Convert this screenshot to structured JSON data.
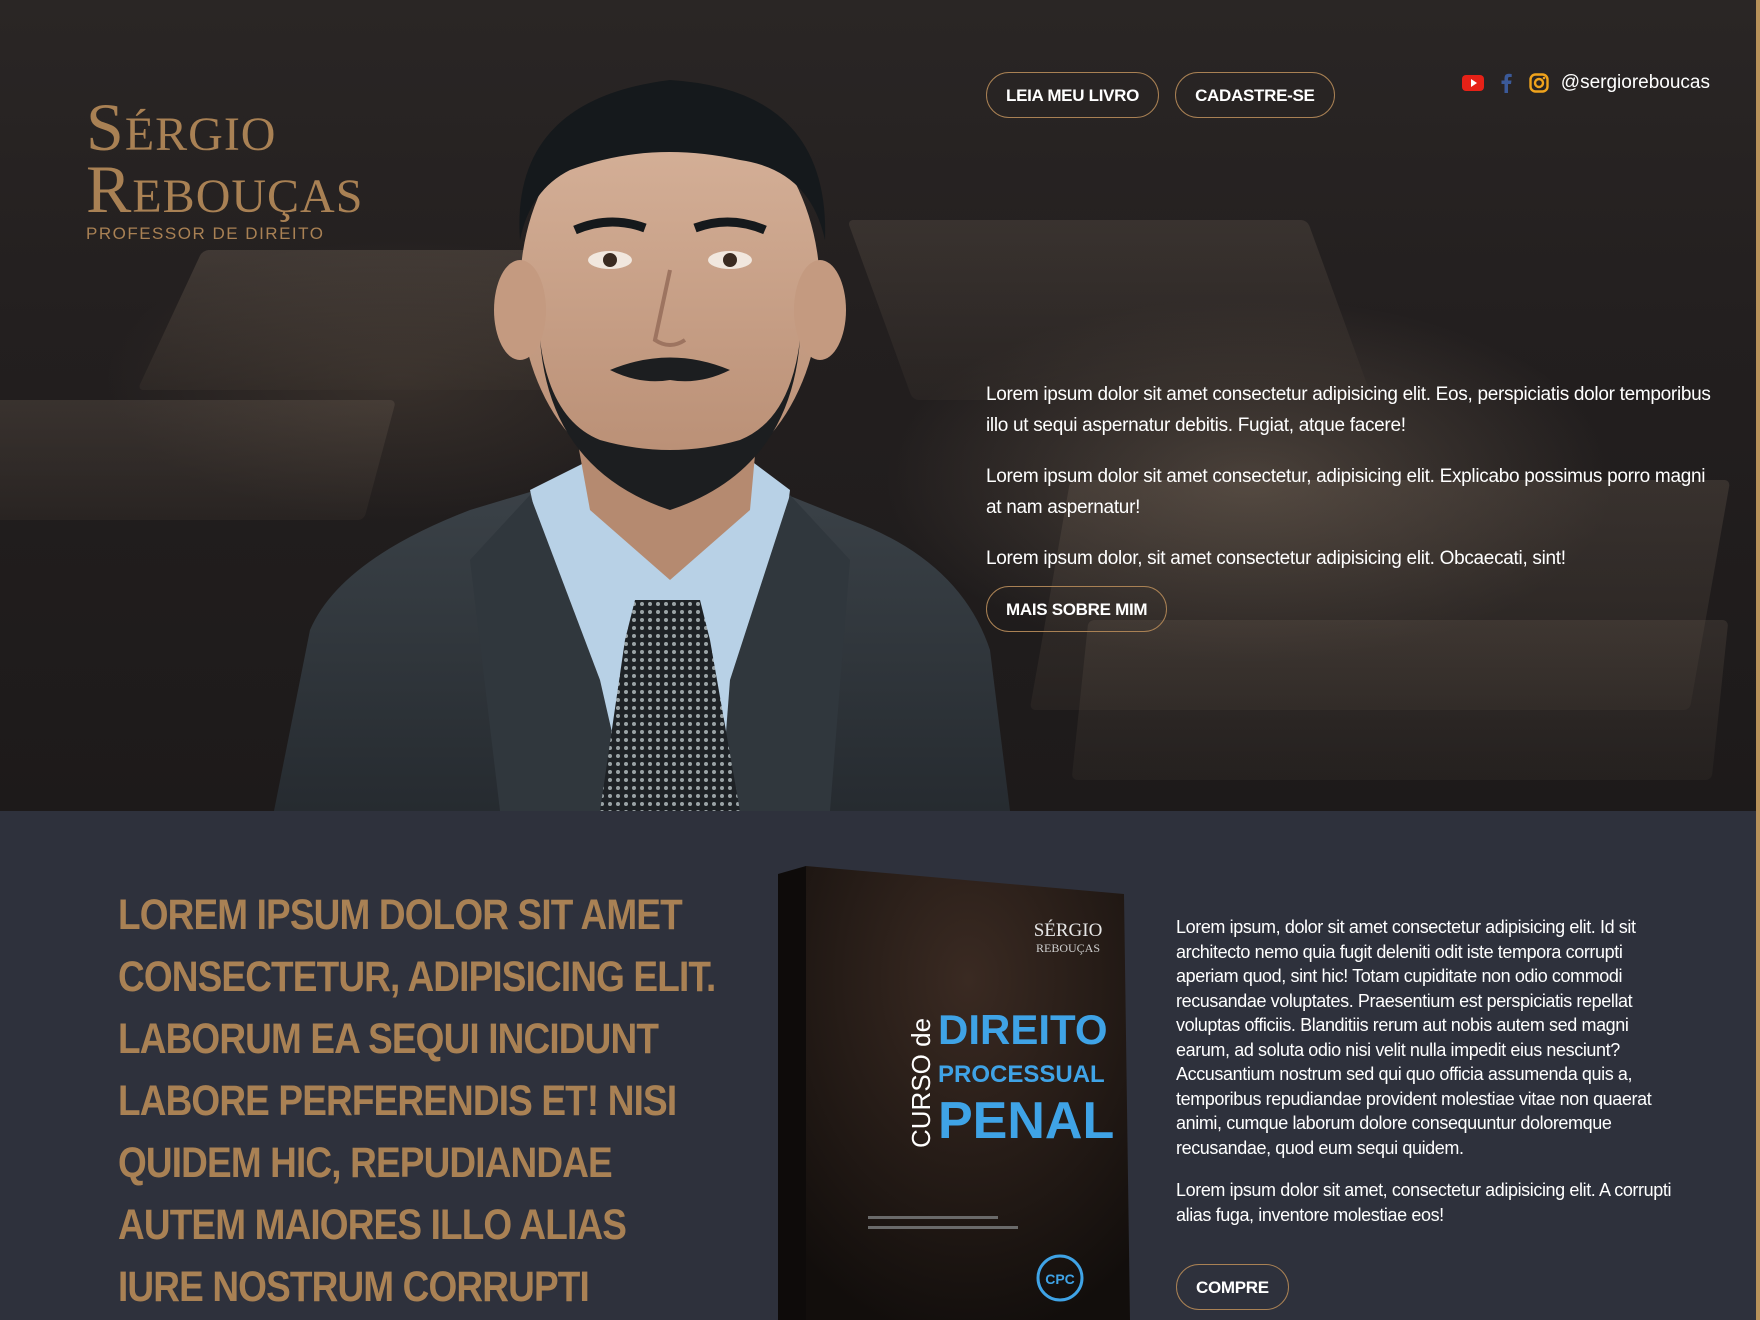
{
  "brand": {
    "name_line1": "Sérgio",
    "name_line2": "Rebouças",
    "subtitle": "PROFESSOR DE DIREITO",
    "accent_color": "#a98154"
  },
  "nav": {
    "read_book": "LEIA MEU LIVRO",
    "signup": "CADASTRE-SE"
  },
  "social": {
    "icons": [
      "youtube-icon",
      "facebook-icon",
      "instagram-icon"
    ],
    "handle": "@sergioreboucas"
  },
  "hero": {
    "paragraphs": [
      "Lorem ipsum dolor sit amet consectetur adipisicing elit. Eos, perspiciatis dolor temporibus illo ut sequi aspernatur debitis. Fugiat, atque facere!",
      "Lorem ipsum dolor sit amet consectetur, adipisicing elit. Explicabo possimus porro magni at nam aspernatur!",
      "Lorem ipsum dolor, sit amet consectetur adipisicing elit. Obcaecati, sint!"
    ],
    "cta": "MAIS SOBRE MIM"
  },
  "book_section": {
    "headline": "Lorem ipsum dolor sit amet consectetur, adipisicing elit. Laborum ea sequi incidunt labore perferendis et! Nisi quidem hic, repudiandae autem maiores illo alias iure nostrum corrupti excepturi animi ipsa? Omnis.",
    "book_cover": {
      "author_line1": "SÉRGIO",
      "author_line2": "REBOUÇAS",
      "curso": "CURSO de",
      "title_line1": "DIREITO",
      "title_line2": "PROCESSUAL",
      "title_line3": "PENAL",
      "badge": "CPC"
    },
    "paragraphs": [
      "Lorem ipsum, dolor sit amet consectetur adipisicing elit. Id sit architecto nemo quia fugit deleniti odit iste tempora corrupti aperiam quod, sint hic! Totam cupiditate non odio commodi recusandae voluptates. Praesentium est perspiciatis repellat voluptas officiis. Blanditiis rerum aut nobis autem sed magni earum, ad soluta odio nisi velit nulla impedit eius nesciunt? Accusantium nostrum sed qui quo officia assumenda quis a, temporibus repudiandae provident molestiae vitae non quaerat animi, cumque laborum dolore consequuntur doloremque recusandae, quod eum sequi quidem.",
      "Lorem ipsum dolor sit amet, consectetur adipisicing elit. A corrupti alias fuga, inventore molestiae eos!"
    ],
    "buy": "COMPRE"
  }
}
